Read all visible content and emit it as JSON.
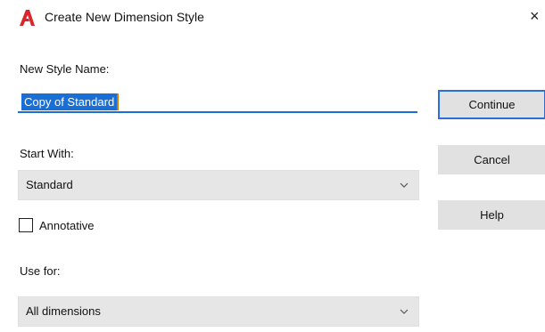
{
  "window": {
    "title": "Create New Dimension Style",
    "close_glyph": "×",
    "icon": "autocad-icon",
    "icon_color": "#d9262d"
  },
  "new_style_name": {
    "label": "New Style Name:",
    "value": "Copy of Standard"
  },
  "start_with": {
    "label": "Start With:",
    "selected": "Standard"
  },
  "annotative": {
    "label": "Annotative",
    "checked": false
  },
  "use_for": {
    "label": "Use for:",
    "selected": "All dimensions"
  },
  "buttons": {
    "continue": "Continue",
    "cancel": "Cancel",
    "help": "Help"
  },
  "colors": {
    "accent": "#1a6fd6",
    "combo_bg": "#e6e6e6",
    "button_bg": "#e1e1e1"
  }
}
